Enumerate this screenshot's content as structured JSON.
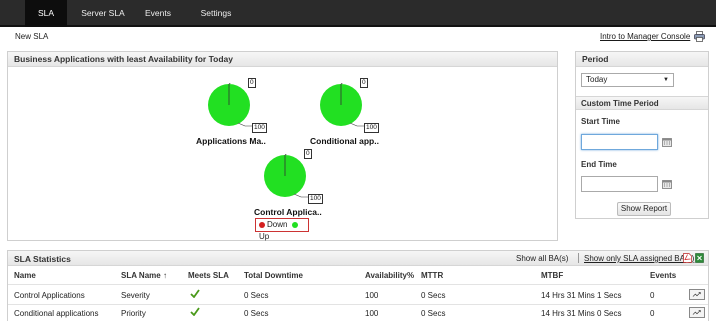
{
  "nav": {
    "tabs": [
      "SLA",
      "Server SLA",
      "Events",
      "Settings"
    ],
    "active_tab": "SLA"
  },
  "subbar": {
    "new_sla": "New SLA",
    "intro_link": "Intro to Manager Console"
  },
  "ba_panel": {
    "title": "Business Applications with least Availability for Today",
    "charts": [
      {
        "label": "Applications Ma..",
        "down": 0,
        "up": 100
      },
      {
        "label": "Conditional app..",
        "down": 0,
        "up": 100
      },
      {
        "label": "Control Applica..",
        "down": 0,
        "up": 100
      }
    ],
    "legend": {
      "down": "Down",
      "up": "Up"
    },
    "colors": {
      "up": "#22e022",
      "down": "#d42020"
    }
  },
  "period_panel": {
    "title": "Period",
    "selected": "Today",
    "custom_title": "Custom Time Period",
    "start_label": "Start Time",
    "start_value": "",
    "end_label": "End Time",
    "end_value": "",
    "button": "Show Report"
  },
  "stats": {
    "title": "SLA Statistics",
    "show_all": "Show all BA(s)",
    "show_only": "Show only SLA assigned BA(s)",
    "columns": [
      "Name",
      "SLA Name",
      "Meets SLA",
      "Total Downtime",
      "Availability%",
      "MTTR",
      "MTBF",
      "Events"
    ],
    "sort_indicator": "↑",
    "rows": [
      {
        "name": "Control Applications",
        "sla_name": "Severity",
        "meets_sla": "check-icon",
        "downtime": "0 Secs",
        "availability": "100",
        "mttr": "0 Secs",
        "mtbf": "14 Hrs 31 Mins 1 Secs",
        "events": "0"
      },
      {
        "name": "Conditional applications",
        "sla_name": "Priority",
        "meets_sla": "check-icon",
        "downtime": "0 Secs",
        "availability": "100",
        "mttr": "0 Secs",
        "mtbf": "14 Hrs 31 Mins 0 Secs",
        "events": "0"
      }
    ]
  }
}
